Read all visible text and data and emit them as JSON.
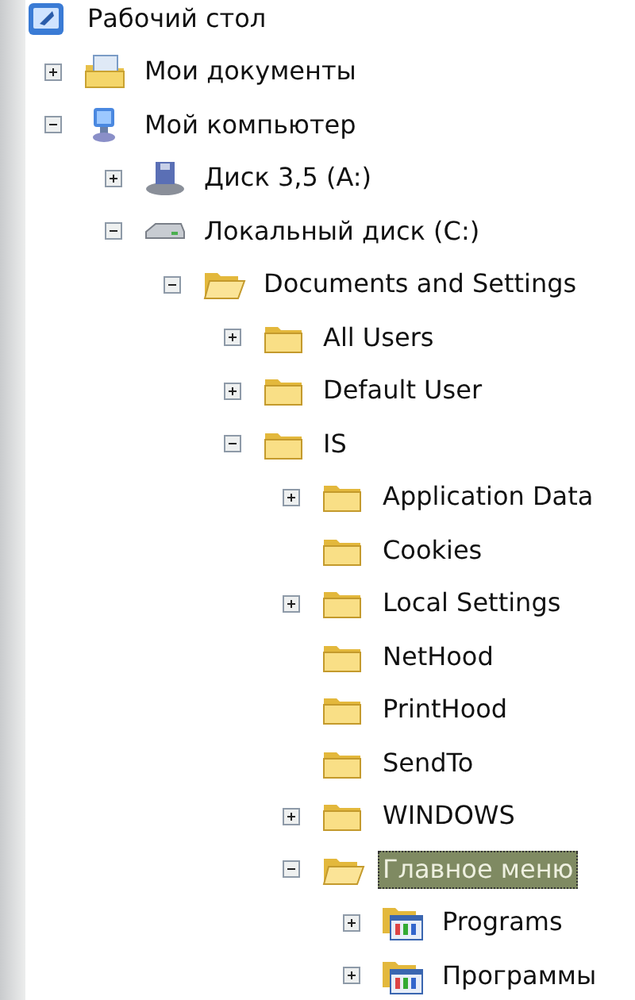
{
  "tree": [
    {
      "label": "Рабочий стол",
      "kind": "desktop",
      "selected": false,
      "children": [
        {
          "label": "Мои документы",
          "kind": "documents",
          "expanded": false,
          "selected": false
        },
        {
          "label": "Мой компьютер",
          "kind": "computer",
          "expanded": true,
          "selected": false,
          "children": [
            {
              "label": "Диск 3,5 (A:)",
              "kind": "floppy",
              "expanded": false,
              "selected": false
            },
            {
              "label": "Локальный диск (C:)",
              "kind": "drive",
              "expanded": true,
              "selected": false,
              "children": [
                {
                  "label": "Documents and Settings",
                  "kind": "folder-open",
                  "expanded": true,
                  "selected": false,
                  "children": [
                    {
                      "label": "All Users",
                      "kind": "folder",
                      "expanded": false,
                      "selected": false
                    },
                    {
                      "label": "Default User",
                      "kind": "folder",
                      "expanded": false,
                      "selected": false
                    },
                    {
                      "label": "IS",
                      "kind": "folder",
                      "expanded": true,
                      "selected": false,
                      "children": [
                        {
                          "label": "Application Data",
                          "kind": "folder",
                          "expanded": false,
                          "selected": false
                        },
                        {
                          "label": "Cookies",
                          "kind": "folder",
                          "selected": false
                        },
                        {
                          "label": "Local Settings",
                          "kind": "folder",
                          "expanded": false,
                          "selected": false
                        },
                        {
                          "label": "NetHood",
                          "kind": "folder",
                          "selected": false
                        },
                        {
                          "label": "PrintHood",
                          "kind": "folder",
                          "selected": false
                        },
                        {
                          "label": "SendTo",
                          "kind": "folder",
                          "selected": false
                        },
                        {
                          "label": "WINDOWS",
                          "kind": "folder",
                          "expanded": false,
                          "selected": false
                        },
                        {
                          "label": "Главное меню",
                          "kind": "folder-open",
                          "expanded": true,
                          "selected": true,
                          "children": [
                            {
                              "label": "Programs",
                              "kind": "programs",
                              "expanded": false,
                              "selected": false
                            },
                            {
                              "label": "Программы",
                              "kind": "programs",
                              "expanded": false,
                              "selected": false
                            }
                          ]
                        }
                      ]
                    }
                  ]
                }
              ]
            }
          ]
        }
      ]
    }
  ]
}
